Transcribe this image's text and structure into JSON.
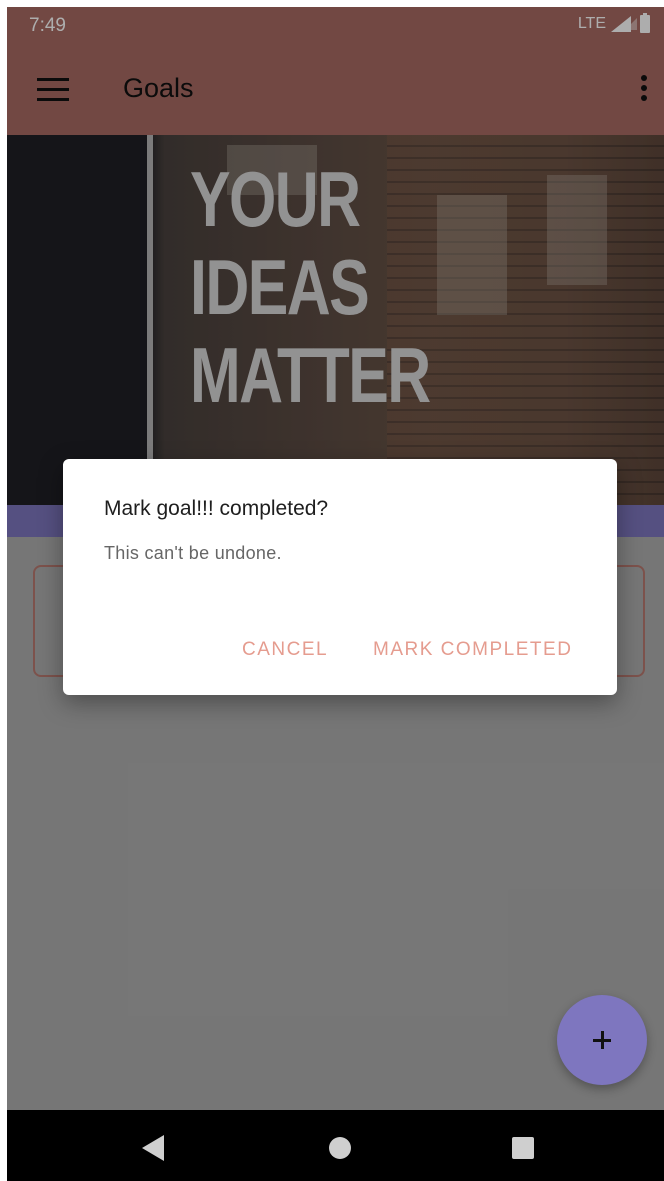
{
  "status_bar": {
    "time": "7:49",
    "network": "LTE"
  },
  "app_bar": {
    "title": "Goals"
  },
  "header_image": {
    "text": "YOUR\nIDEAS\nMATTER"
  },
  "dialog": {
    "title": "Mark goal!!! completed?",
    "message": "This can't be undone.",
    "cancel_label": "CANCEL",
    "confirm_label": "MARK COMPLETED"
  },
  "fab": {
    "icon": "plus-icon"
  },
  "nav_bar": {
    "icons": [
      "back-icon",
      "home-icon",
      "recents-icon"
    ]
  },
  "colors": {
    "app_bar": "#a86b63",
    "accent": "#7e76bf",
    "dialog_button": "#e59c8f"
  }
}
